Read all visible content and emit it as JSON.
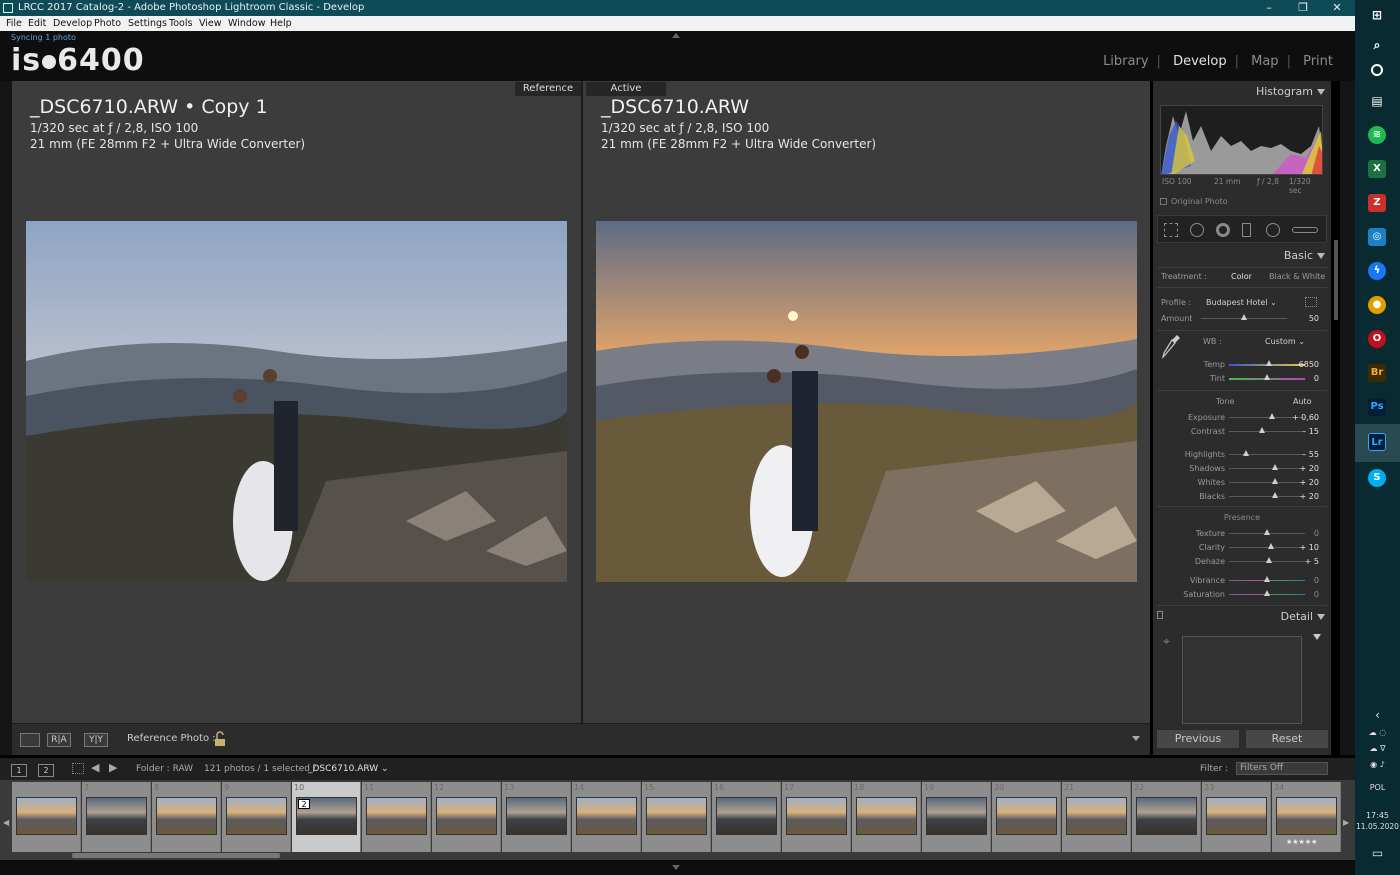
{
  "window": {
    "title": "LRCC 2017 Catalog-2 - Adobe Photoshop Lightroom Classic - Develop",
    "minimize": "–",
    "maximize": "❐",
    "close": "✕"
  },
  "menu": [
    "File",
    "Edit",
    "Develop",
    "Photo",
    "Settings",
    "Tools",
    "View",
    "Window",
    "Help"
  ],
  "header": {
    "sync_status": "Syncing 1 photo",
    "logo_text_a": "is",
    "logo_text_b": "6400",
    "modules": [
      "Library",
      "Develop",
      "Map",
      "Print"
    ],
    "active_module": "Develop"
  },
  "compare": {
    "left": {
      "tag": "Reference",
      "filename": "_DSC6710.ARW • Copy 1",
      "exposure_line": "1/320 sec at ƒ / 2,8, ISO 100",
      "lens_line": "21 mm (FE 28mm F2 + Ultra Wide Converter)"
    },
    "right": {
      "tag": "Active",
      "filename": "_DSC6710.ARW",
      "exposure_line": "1/320 sec at ƒ / 2,8, ISO 100",
      "lens_line": "21 mm (FE 28mm F2 + Ultra Wide Converter)"
    }
  },
  "toolbar": {
    "ra_label": "R|A",
    "yy_label": "Y|Y",
    "reference_photo_label": "Reference Photo :"
  },
  "histogram": {
    "title": "Histogram",
    "iso": "ISO 100",
    "focal": "21 mm",
    "aperture": "ƒ / 2,8",
    "shutter": "1/320 sec",
    "original_photo": "Original Photo"
  },
  "basic": {
    "title": "Basic",
    "treatment_label": "Treatment :",
    "treatment_color": "Color",
    "treatment_bw": "Black & White",
    "profile_label": "Profile :",
    "profile_value": "Budapest Hotel ⌄",
    "amount_label": "Amount",
    "amount_value": "50",
    "amount_pos": 0.5,
    "wb_label": "WB :",
    "wb_value": "Custom ⌄",
    "temp_label": "Temp",
    "temp_value": "6850",
    "temp_pos": 0.52,
    "tint_label": "Tint",
    "tint_value": "0",
    "tint_pos": 0.5,
    "tone_label": "Tone",
    "auto_label": "Auto",
    "sliders": [
      {
        "label": "Exposure",
        "value": "+ 0,60",
        "pos": 0.56
      },
      {
        "label": "Contrast",
        "value": "– 15",
        "pos": 0.43
      },
      {
        "label": "Highlights",
        "value": "– 55",
        "pos": 0.22
      },
      {
        "label": "Shadows",
        "value": "+ 20",
        "pos": 0.6
      },
      {
        "label": "Whites",
        "value": "+ 20",
        "pos": 0.6
      },
      {
        "label": "Blacks",
        "value": "+ 20",
        "pos": 0.6
      }
    ],
    "presence_label": "Presence",
    "presence": [
      {
        "label": "Texture",
        "value": "0",
        "pos": 0.5
      },
      {
        "label": "Clarity",
        "value": "+ 10",
        "pos": 0.55
      },
      {
        "label": "Dehaze",
        "value": "+ 5",
        "pos": 0.525
      },
      {
        "label": "Vibrance",
        "value": "0",
        "pos": 0.5
      },
      {
        "label": "Saturation",
        "value": "0",
        "pos": 0.5
      }
    ]
  },
  "detail": {
    "title": "Detail"
  },
  "buttons": {
    "previous": "Previous",
    "reset": "Reset"
  },
  "filmstrip_bar": {
    "screen1": "1",
    "screen2": "2",
    "folder": "Folder : RAW",
    "count": "121 photos / 1 selected /",
    "current_file": "_DSC6710.ARW ⌄",
    "filter_label": "Filter :",
    "filter_value": "Filters Off"
  },
  "filmstrip": {
    "numbers": [
      "",
      "7",
      "8",
      "9",
      "10",
      "11",
      "12",
      "13",
      "14",
      "15",
      "16",
      "17",
      "18",
      "19",
      "20",
      "21",
      "22",
      "23",
      "24"
    ],
    "selected_index": 4,
    "selected_badge": "2",
    "rating_stars": "★★★★★"
  },
  "taskbar": {
    "time": "17:45",
    "date": "11.05.2020",
    "lang": "POL"
  }
}
